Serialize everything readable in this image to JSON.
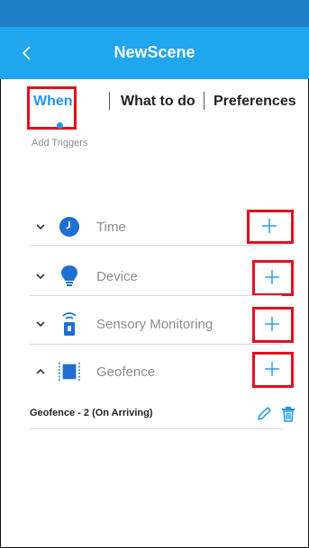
{
  "header": {
    "title": "NewScene",
    "back_icon": "chevron-left-icon"
  },
  "tabs": [
    {
      "label": "When",
      "active": true
    },
    {
      "label": "What to do",
      "active": false
    },
    {
      "label": "Preferences",
      "active": false
    }
  ],
  "section": {
    "subtitle": "Add Triggers"
  },
  "triggers": [
    {
      "label": "Time",
      "icon": "clock-icon",
      "expanded": false
    },
    {
      "label": "Device",
      "icon": "lightbulb-icon",
      "expanded": false
    },
    {
      "label": "Sensory Monitoring",
      "icon": "sensor-lock-icon",
      "expanded": false
    },
    {
      "label": "Geofence",
      "icon": "geofence-icon",
      "expanded": true
    }
  ],
  "geofence_items": [
    {
      "label": "Geofence - 2 (On Arriving)"
    }
  ],
  "colors": {
    "status_bar": "#1E7FC6",
    "app_bar": "#1FA6EE",
    "accent": "#1F96E5",
    "highlight": "#E3101D"
  }
}
